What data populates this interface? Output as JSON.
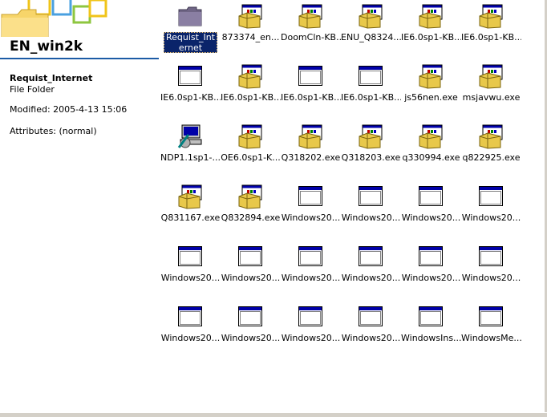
{
  "left_panel": {
    "folder_title": "EN_win2k",
    "selected_name": "Requist_Internet",
    "selected_type": "File Folder",
    "modified": "Modified: 2005-4-13 15:06",
    "attributes": "Attributes: (normal)"
  },
  "items": [
    {
      "label": "Requist_Internet",
      "icon": "folder-icon",
      "selected": true
    },
    {
      "label": "873374_en...",
      "icon": "installer-package-icon"
    },
    {
      "label": "DoomCln-KB...",
      "icon": "installer-package-icon"
    },
    {
      "label": "ENU_Q8324...",
      "icon": "installer-package-icon"
    },
    {
      "label": "IE6.0sp1-KB...",
      "icon": "installer-package-icon"
    },
    {
      "label": "IE6.0sp1-KB...",
      "icon": "installer-package-icon"
    },
    {
      "label": "IE6.0sp1-KB...",
      "icon": "application-window-icon"
    },
    {
      "label": "IE6.0sp1-KB...",
      "icon": "installer-package-icon"
    },
    {
      "label": "IE6.0sp1-KB...",
      "icon": "application-window-icon"
    },
    {
      "label": "IE6.0sp1-KB...",
      "icon": "application-window-icon"
    },
    {
      "label": "js56nen.exe",
      "icon": "installer-package-icon"
    },
    {
      "label": "msjavwu.exe",
      "icon": "installer-package-icon"
    },
    {
      "label": "NDP1.1sp1-...",
      "icon": "setup-computer-icon"
    },
    {
      "label": "OE6.0sp1-K...",
      "icon": "installer-package-icon"
    },
    {
      "label": "Q318202.exe",
      "icon": "installer-package-icon"
    },
    {
      "label": "Q318203.exe",
      "icon": "installer-package-icon"
    },
    {
      "label": "q330994.exe",
      "icon": "installer-package-icon"
    },
    {
      "label": "q822925.exe",
      "icon": "installer-package-icon"
    },
    {
      "label": "Q831167.exe",
      "icon": "installer-package-icon"
    },
    {
      "label": "Q832894.exe",
      "icon": "installer-package-icon"
    },
    {
      "label": "Windows20...",
      "icon": "application-window-icon"
    },
    {
      "label": "Windows20...",
      "icon": "application-window-icon"
    },
    {
      "label": "Windows20...",
      "icon": "application-window-icon"
    },
    {
      "label": "Windows20...",
      "icon": "application-window-icon"
    },
    {
      "label": "Windows20...",
      "icon": "application-window-icon"
    },
    {
      "label": "Windows20...",
      "icon": "application-window-icon"
    },
    {
      "label": "Windows20...",
      "icon": "application-window-icon"
    },
    {
      "label": "Windows20...",
      "icon": "application-window-icon"
    },
    {
      "label": "Windows20...",
      "icon": "application-window-icon"
    },
    {
      "label": "Windows20...",
      "icon": "application-window-icon"
    },
    {
      "label": "Windows20...",
      "icon": "application-window-icon"
    },
    {
      "label": "Windows20...",
      "icon": "application-window-icon"
    },
    {
      "label": "Windows20...",
      "icon": "application-window-icon"
    },
    {
      "label": "Windows20...",
      "icon": "application-window-icon"
    },
    {
      "label": "WindowsIns...",
      "icon": "application-window-icon"
    },
    {
      "label": "WindowsMe...",
      "icon": "application-window-icon"
    }
  ],
  "colors": {
    "selection": "#0a246a",
    "title_bar_blue": "#0000a8",
    "title_underline": "#1c5ba5",
    "folder_purple": "#7b6f8e"
  }
}
